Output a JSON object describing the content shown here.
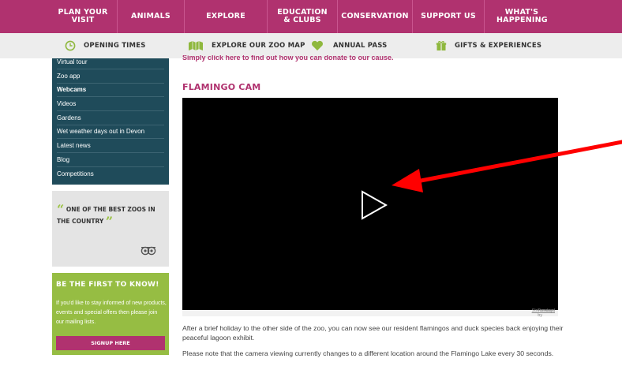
{
  "nav": {
    "items": [
      {
        "label": "PLAN YOUR VISIT"
      },
      {
        "label": "ANIMALS"
      },
      {
        "label": "EXPLORE"
      },
      {
        "label": "EDUCATION & CLUBS"
      },
      {
        "label": "CONSERVATION"
      },
      {
        "label": "SUPPORT US"
      },
      {
        "label": "WHAT'S HAPPENING"
      }
    ]
  },
  "subnav": {
    "opening_times": "OPENING TIMES",
    "zoo_map": "EXPLORE OUR ZOO MAP",
    "annual_pass": "ANNUAL PASS",
    "gifts": "GIFTS & EXPERIENCES"
  },
  "sidebar": {
    "items": [
      {
        "label": "Virtual tour"
      },
      {
        "label": "Zoo app"
      },
      {
        "label": "Webcams"
      },
      {
        "label": "Videos"
      },
      {
        "label": "Gardens"
      },
      {
        "label": "Wet weather days out in Devon"
      },
      {
        "label": "Latest news"
      },
      {
        "label": "Blog"
      },
      {
        "label": "Competitions"
      }
    ],
    "quote": "ONE OF THE BEST ZOOS IN THE COUNTRY",
    "newsletter": {
      "heading": "BE THE FIRST TO KNOW!",
      "text": "If you'd like to stay informed of new products, events and special offers then please join our mailing lists.",
      "button": "SIGNUP HERE"
    }
  },
  "main": {
    "donate_link": "Simply click here to find out how you can donate to our cause.",
    "cam_title": "FLAMINGO CAM",
    "powered_prefix": "Powered by",
    "powered_brand": "Streamdays",
    "para1": "After a brief holiday to the other side of the zoo, you can now see our resident flamingos and duck species back enjoying their peaceful lagoon exhibit.",
    "para2": "Please note that the camera viewing currently changes to a different location around the Flamingo Lake every 30 seconds."
  },
  "colors": {
    "brand": "#b0326f",
    "sidebar_bg": "#1f4b5a",
    "newsletter_bg": "#96bd43",
    "arrow": "#ff0000"
  }
}
